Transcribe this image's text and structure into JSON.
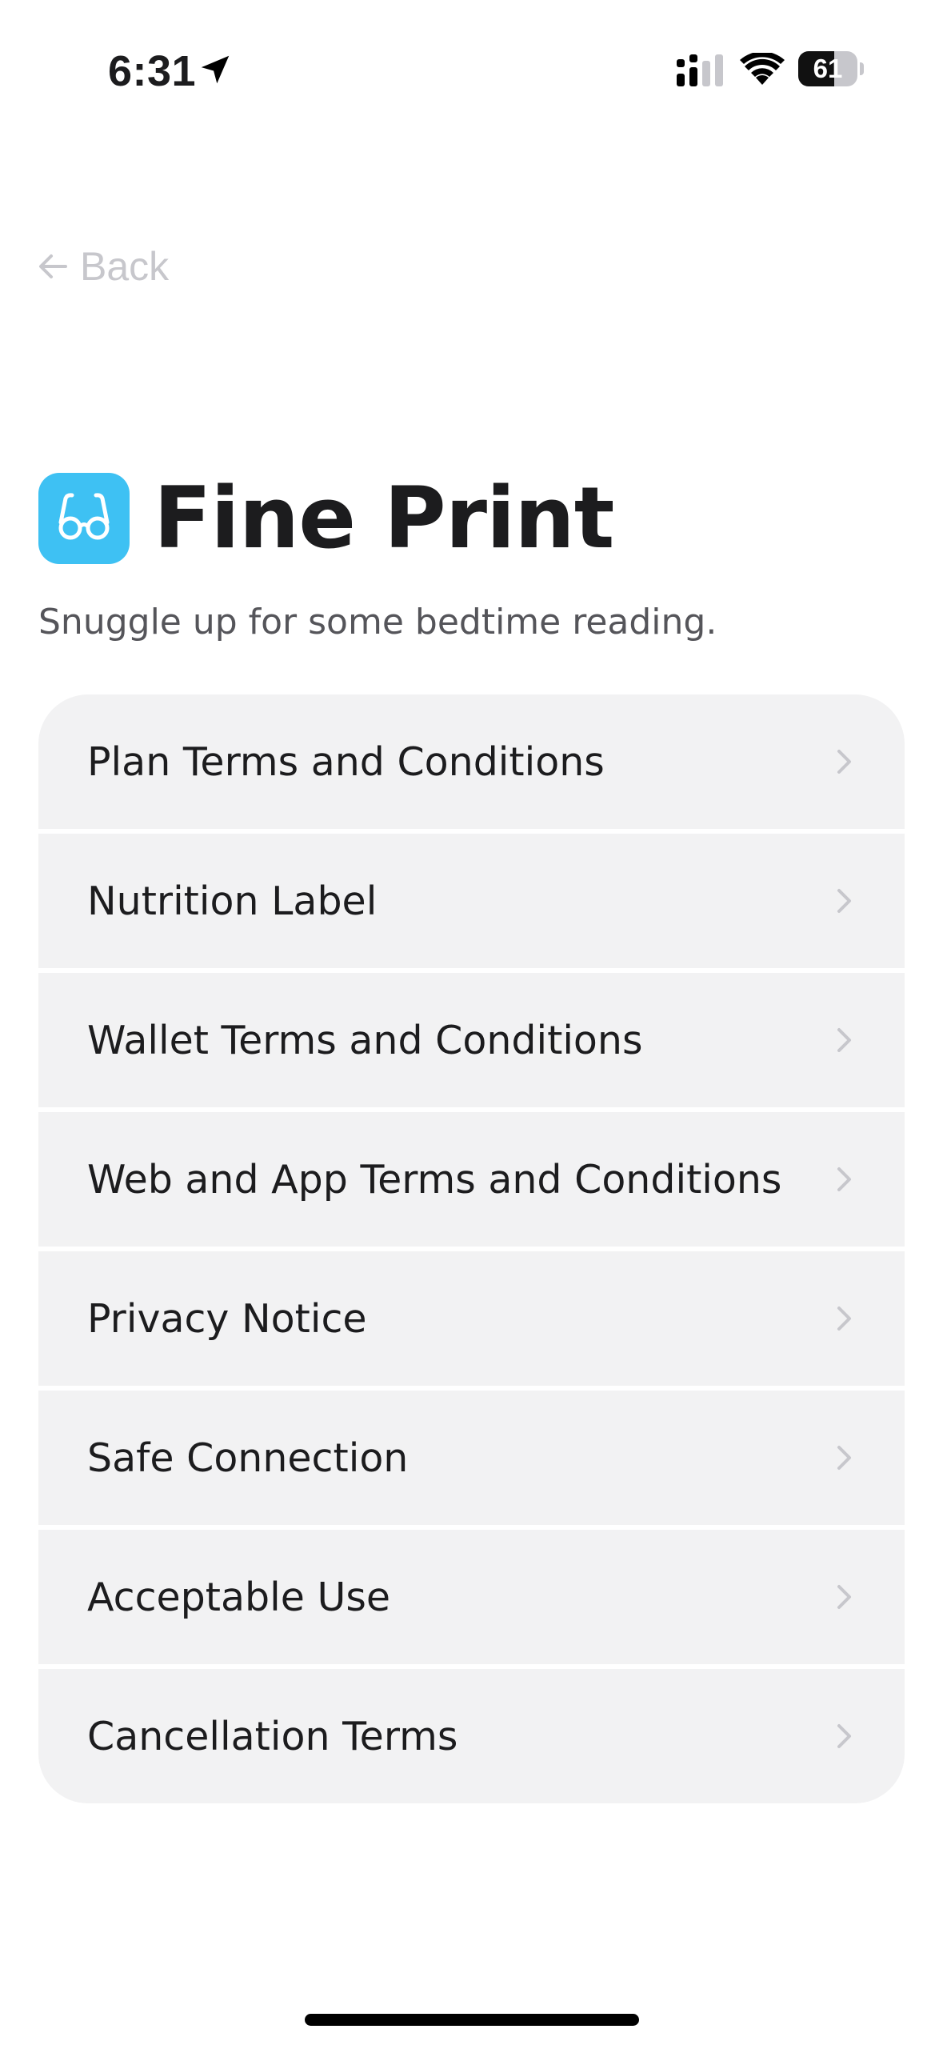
{
  "status_bar": {
    "time": "6:31",
    "battery_level": "61",
    "battery_fraction": 0.61,
    "icons": [
      "location-arrow-icon",
      "cellular-signal-icon",
      "wifi-icon",
      "battery-icon"
    ]
  },
  "navigation": {
    "back_label": "Back",
    "back_icon": "arrow-left-icon"
  },
  "header": {
    "app_icon": "reading-glasses-icon",
    "title": "Fine Print",
    "subtitle": "Snuggle up for some bedtime reading."
  },
  "list": {
    "items": [
      {
        "label": "Plan Terms and Conditions"
      },
      {
        "label": "Nutrition Label"
      },
      {
        "label": "Wallet Terms and Conditions"
      },
      {
        "label": "Web and App Terms and Conditions"
      },
      {
        "label": "Privacy Notice"
      },
      {
        "label": "Safe Connection"
      },
      {
        "label": "Acceptable Use"
      },
      {
        "label": "Cancellation Terms"
      }
    ],
    "item_icon": "chevron-right-icon"
  },
  "colors": {
    "app_icon_background": "#3ec1f3",
    "list_background": "#f2f2f3",
    "back_text": "#c7c7cc",
    "title_text": "#1c1c1e",
    "subtitle_text": "#55555a"
  }
}
